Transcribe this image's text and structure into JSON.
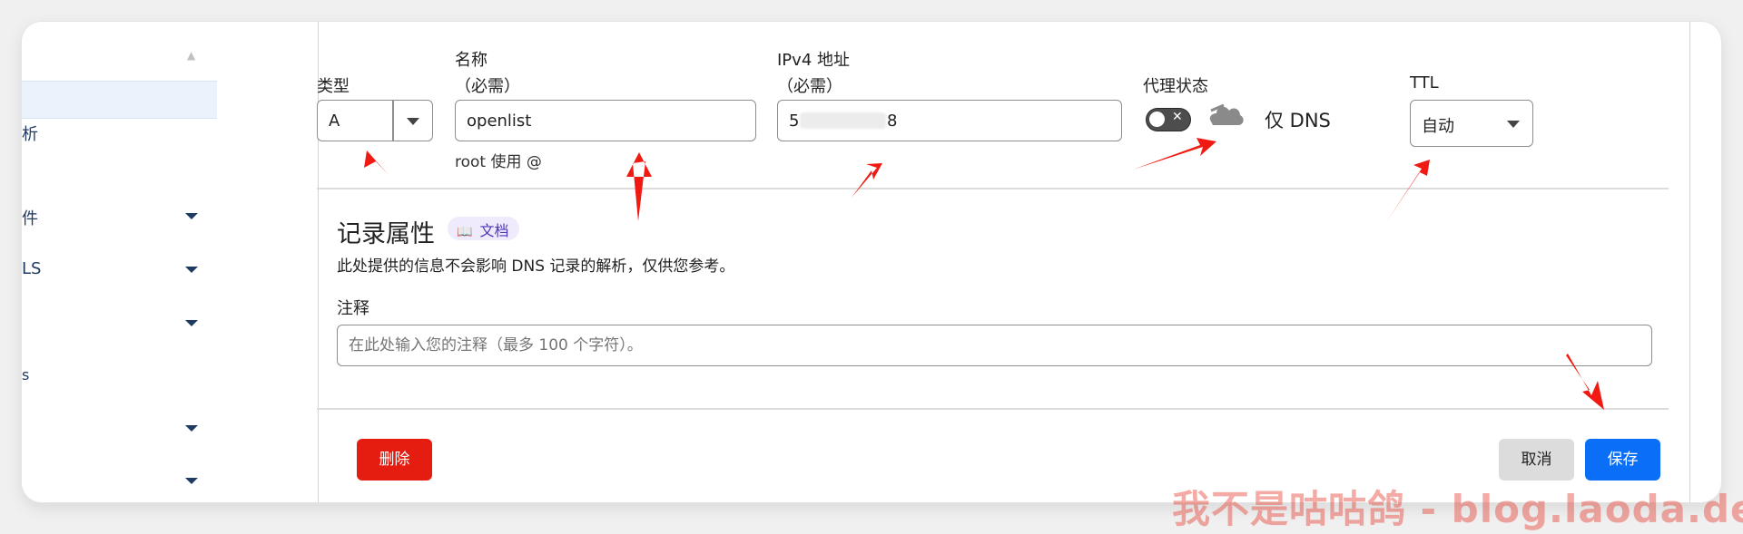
{
  "sidebar": {
    "items": [
      {
        "label": "析",
        "has_caret": false
      },
      {
        "label": "件",
        "has_caret": true
      },
      {
        "label": "LS",
        "has_caret": true
      },
      {
        "label": "",
        "has_caret": true
      },
      {
        "label": "s",
        "has_caret": false
      },
      {
        "label": "",
        "has_caret": true
      },
      {
        "label": "",
        "has_caret": true
      }
    ]
  },
  "form": {
    "type": {
      "label": "类型",
      "value": "A"
    },
    "name": {
      "label": "名称",
      "required": "（必需）",
      "value": "openlist",
      "hint": "root 使用 @"
    },
    "ipv4": {
      "label": "IPv4 地址",
      "required": "（必需）",
      "value_start": "5",
      "value_end": "8"
    },
    "proxy": {
      "label": "代理状态",
      "toggle_state": "off",
      "status_text": "仅 DNS"
    },
    "ttl": {
      "label": "TTL",
      "value": "自动"
    }
  },
  "record_attributes": {
    "title": "记录属性",
    "doc_badge": "文档",
    "description": "此处提供的信息不会影响 DNS 记录的解析，仅供您参考。",
    "comment_label": "注释",
    "comment_placeholder": "在此处输入您的注释（最多 100 个字符）。"
  },
  "actions": {
    "delete": "删除",
    "cancel": "取消",
    "save": "保存"
  },
  "watermark": "我不是咕咕鸽 - blog.laoda.de",
  "colors": {
    "annotation_arrow": "#f01a12",
    "delete_button": "#e51c10",
    "save_button": "#0a6ef7",
    "doc_badge_bg": "#efeafc"
  }
}
